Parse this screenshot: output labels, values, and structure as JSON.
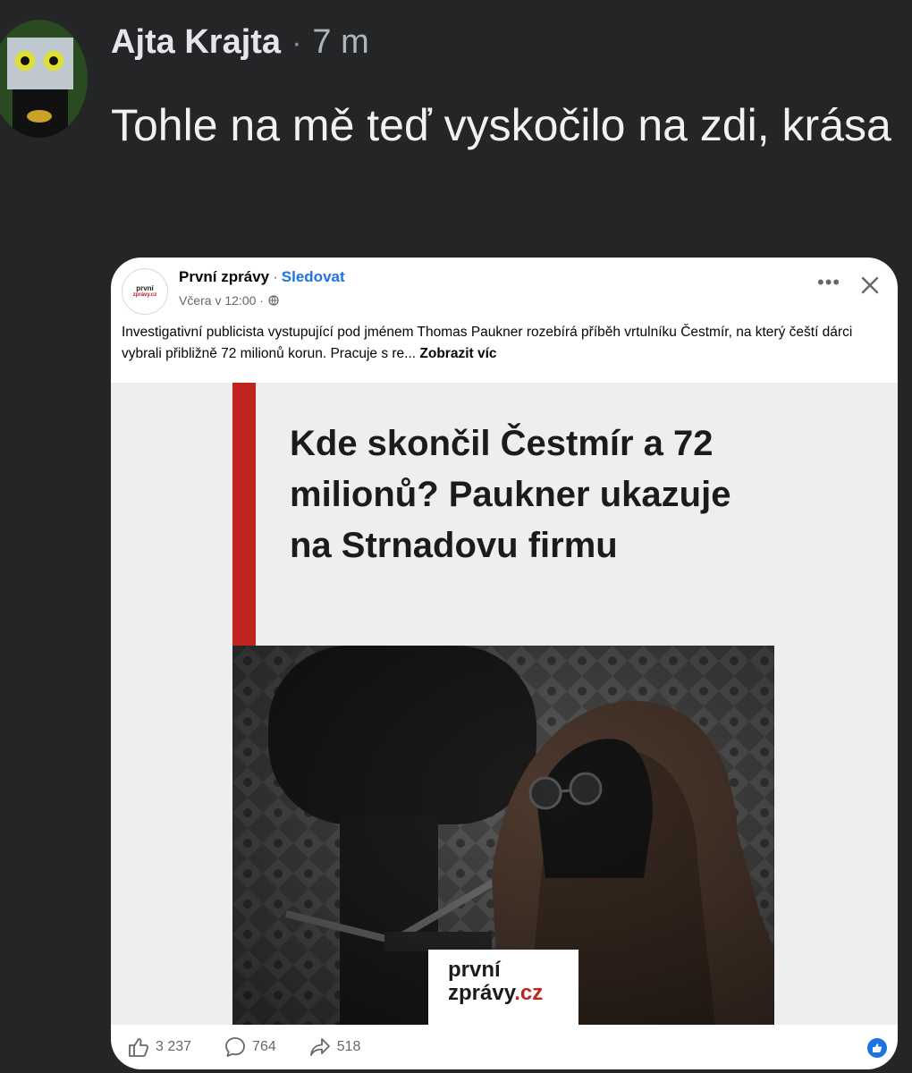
{
  "comment": {
    "author": "Ajta Krajta",
    "separator": "·",
    "time": "7 m",
    "text": "Tohle na mě teď vyskočilo na zdi, krása"
  },
  "shared_post": {
    "page_logo_line1": "první",
    "page_logo_line2": "zprávy.cz",
    "page_name": "První zprávy",
    "name_separator": "·",
    "follow_label": "Sledovat",
    "timestamp": "Včera v 12:00 ·",
    "more_icon": "more-horizontal-icon",
    "close_icon": "close-icon",
    "body_text": "Investigativní publicista vystupující pod jménem Thomas Paukner rozebírá příběh vrtulníku Čestmír, na který čeští dárci vybrali přibližně 72 milionů korun. Pracuje s re...",
    "see_more_label": "Zobrazit víc",
    "article": {
      "headline": "Kde skončil Čestmír a 72 milionů? Paukner ukazuje na Strnadovu firmu",
      "brand_line1": "první",
      "brand_line2_main": "zprávy",
      "brand_line2_tld": ".cz",
      "accent_color": "#c0241f"
    },
    "reactions": {
      "likes": "3 237",
      "comments": "764",
      "shares": "518"
    }
  },
  "colors": {
    "background": "#242526",
    "link_blue": "#1b74e4",
    "secondary_text": "#65676b"
  }
}
